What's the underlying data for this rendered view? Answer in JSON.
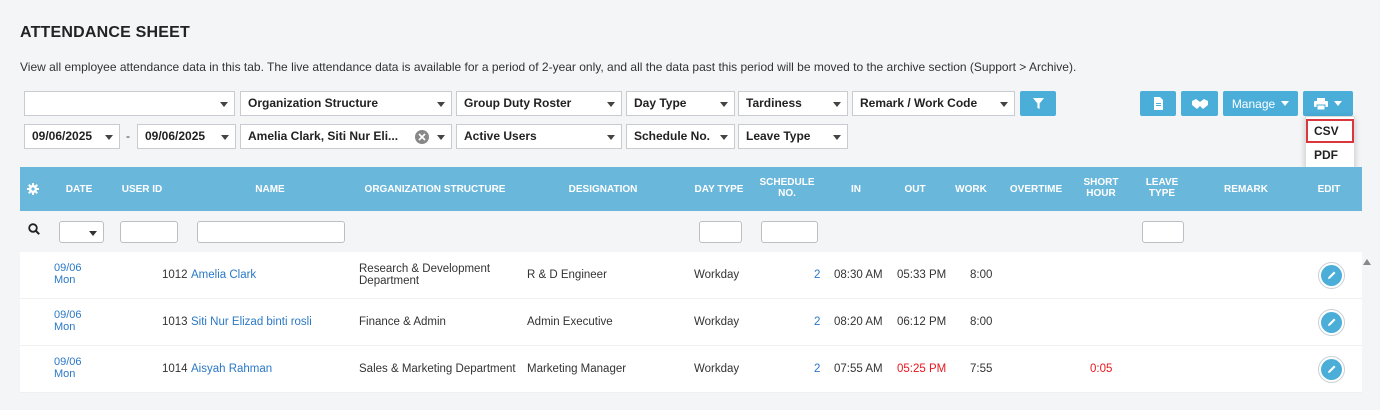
{
  "header": {
    "title": "ATTENDANCE SHEET",
    "description": "View all employee attendance data in this tab. The live attendance data is available for a period of 2-year only, and all the data past this period will be moved to the archive section (Support > Archive)."
  },
  "filters": {
    "row1": {
      "blank_select": "",
      "organization_structure": "Organization Structure",
      "group_duty_roster": "Group Duty Roster",
      "day_type": "Day Type",
      "tardiness": "Tardiness",
      "remark_work_code": "Remark / Work Code"
    },
    "row2": {
      "date_from": "09/06/2025",
      "separator": "-",
      "date_to": "09/06/2025",
      "users": "Amelia Clark, Siti Nur Eli...",
      "user_status": "Active Users",
      "schedule_no": "Schedule No.",
      "leave_type": "Leave Type"
    }
  },
  "toolbar": {
    "manage_label": "Manage",
    "accent_color": "#4aaed9"
  },
  "print_menu": {
    "items": [
      "CSV",
      "PDF"
    ],
    "highlighted": "CSV",
    "highlight_color": "#d9363e"
  },
  "table": {
    "columns": {
      "date": "DATE",
      "user_id": "USER ID",
      "name": "NAME",
      "org_structure": "ORGANIZATION STRUCTURE",
      "designation": "DESIGNATION",
      "day_type": "DAY TYPE",
      "schedule_no_1": "SCHEDULE",
      "schedule_no_2": "NO.",
      "in": "IN",
      "out": "OUT",
      "work": "WORK",
      "overtime": "OVERTIME",
      "short_hour_1": "SHORT",
      "short_hour_2": "HOUR",
      "leave_type_1": "LEAVE",
      "leave_type_2": "TYPE",
      "remark": "REMARK",
      "edit": "EDIT"
    },
    "header_color": "#6ab7dc",
    "rows": [
      {
        "date": "09/06",
        "day": "Mon",
        "user_id": "1012",
        "name": "Amelia Clark",
        "org_line1": "Research & Development",
        "org_line2": "Department",
        "designation": "R & D Engineer",
        "day_type": "Workday",
        "schedule_no": "2",
        "in": "08:30 AM",
        "out": "05:33 PM",
        "work": "8:00",
        "short_hour": ""
      },
      {
        "date": "09/06",
        "day": "Mon",
        "user_id": "1013",
        "name": "Siti Nur Elizad binti rosli",
        "org_line1": "Finance & Admin",
        "org_line2": "",
        "designation": "Admin Executive",
        "day_type": "Workday",
        "schedule_no": "2",
        "in": "08:20 AM",
        "out": "06:12 PM",
        "work": "8:00",
        "short_hour": ""
      },
      {
        "date": "09/06",
        "day": "Mon",
        "user_id": "1014",
        "name": "Aisyah Rahman",
        "org_line1": "Sales & Marketing Department",
        "org_line2": "",
        "designation": "Marketing Manager",
        "day_type": "Workday",
        "schedule_no": "2",
        "in": "07:55 AM",
        "out": "05:25 PM",
        "work": "7:55",
        "short_hour": "0:05"
      }
    ]
  }
}
